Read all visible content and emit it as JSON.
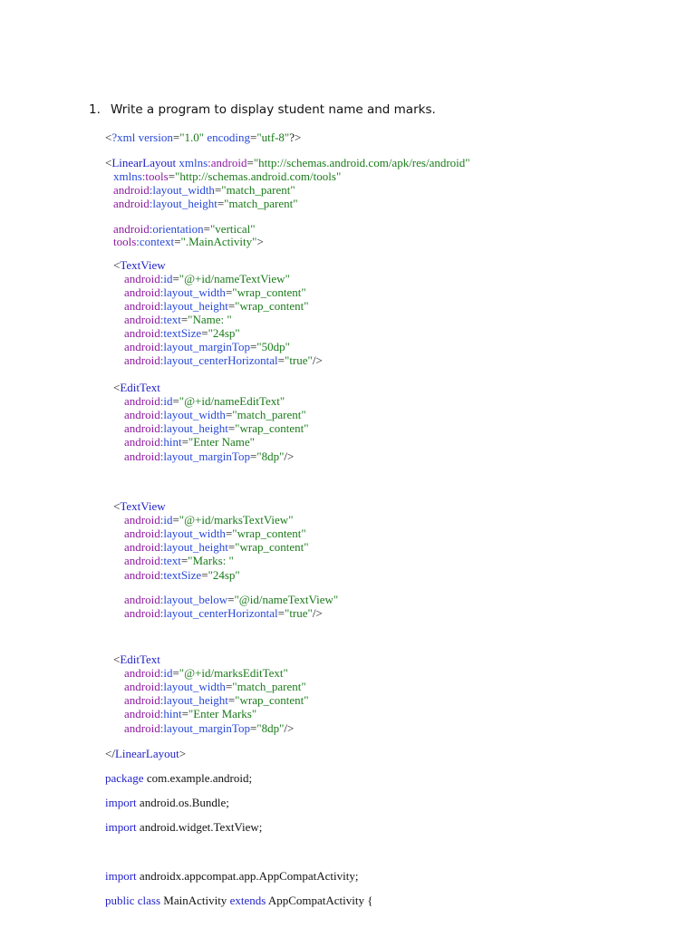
{
  "heading": {
    "number": "1.",
    "text": "Write a program to display student name and marks."
  },
  "code_lines": [
    [
      [
        "p",
        "<"
      ],
      [
        "a",
        "?xml version"
      ],
      [
        "p",
        "="
      ],
      [
        "v",
        "\"1.0\""
      ],
      [
        "a",
        " encoding"
      ],
      [
        "p",
        "="
      ],
      [
        "v",
        "\"utf-8\""
      ],
      [
        "p",
        "?>"
      ]
    ],
    [
      [
        "p",
        "<"
      ],
      [
        "t",
        "LinearLayout"
      ],
      [
        "a",
        " xmlns"
      ],
      [
        "ns",
        ":android"
      ],
      [
        "p",
        "="
      ],
      [
        "v",
        "\"http://schemas.android.com/apk/res/android\""
      ]
    ],
    [
      [
        "a",
        "xmlns"
      ],
      [
        "ns",
        ":tools"
      ],
      [
        "p",
        "="
      ],
      [
        "v",
        "\"http://schemas.android.com/tools\""
      ]
    ],
    [
      [
        "ns",
        "android"
      ],
      [
        "a",
        ":layout_width"
      ],
      [
        "p",
        "="
      ],
      [
        "v",
        "\"match_parent\""
      ]
    ],
    [
      [
        "ns",
        "android"
      ],
      [
        "a",
        ":layout_height"
      ],
      [
        "p",
        "="
      ],
      [
        "v",
        "\"match_parent\""
      ]
    ],
    [
      [
        "ns",
        "android"
      ],
      [
        "a",
        ":orientation"
      ],
      [
        "p",
        "="
      ],
      [
        "v",
        "\"vertical\""
      ]
    ],
    [
      [
        "ns",
        "tools"
      ],
      [
        "a",
        ":context"
      ],
      [
        "p",
        "="
      ],
      [
        "v",
        "\".MainActivity\""
      ],
      [
        "p",
        ">"
      ]
    ],
    [
      [
        "p",
        "<"
      ],
      [
        "t",
        "TextView"
      ]
    ],
    [
      [
        "ns",
        "android"
      ],
      [
        "a",
        ":id"
      ],
      [
        "p",
        "="
      ],
      [
        "v",
        "\"@+id/nameTextView\""
      ]
    ],
    [
      [
        "ns",
        "android"
      ],
      [
        "a",
        ":layout_width"
      ],
      [
        "p",
        "="
      ],
      [
        "v",
        "\"wrap_content\""
      ]
    ],
    [
      [
        "ns",
        "android"
      ],
      [
        "a",
        ":layout_height"
      ],
      [
        "p",
        "="
      ],
      [
        "v",
        "\"wrap_content\""
      ]
    ],
    [
      [
        "ns",
        "android"
      ],
      [
        "a",
        ":text"
      ],
      [
        "p",
        "="
      ],
      [
        "v",
        "\"Name: \""
      ]
    ],
    [
      [
        "ns",
        "android"
      ],
      [
        "a",
        ":textSize"
      ],
      [
        "p",
        "="
      ],
      [
        "v",
        "\"24sp\""
      ]
    ],
    [
      [
        "ns",
        "android"
      ],
      [
        "a",
        ":layout_marginTop"
      ],
      [
        "p",
        "="
      ],
      [
        "v",
        "\"50dp\""
      ]
    ],
    [
      [
        "ns",
        "android"
      ],
      [
        "a",
        ":layout_centerHorizontal"
      ],
      [
        "p",
        "="
      ],
      [
        "v",
        "\"true\""
      ],
      [
        "p",
        "/>"
      ]
    ],
    [
      [
        "p",
        "<"
      ],
      [
        "t",
        "EditText"
      ]
    ],
    [
      [
        "ns",
        "android"
      ],
      [
        "a",
        ":id"
      ],
      [
        "p",
        "="
      ],
      [
        "v",
        "\"@+id/nameEditText\""
      ]
    ],
    [
      [
        "ns",
        "android"
      ],
      [
        "a",
        ":layout_width"
      ],
      [
        "p",
        "="
      ],
      [
        "v",
        "\"match_parent\""
      ]
    ],
    [
      [
        "ns",
        "android"
      ],
      [
        "a",
        ":layout_height"
      ],
      [
        "p",
        "="
      ],
      [
        "v",
        "\"wrap_content\""
      ]
    ],
    [
      [
        "ns",
        "android"
      ],
      [
        "a",
        ":hint"
      ],
      [
        "p",
        "="
      ],
      [
        "v",
        "\"Enter Name\""
      ]
    ],
    [
      [
        "ns",
        "android"
      ],
      [
        "a",
        ":layout_marginTop"
      ],
      [
        "p",
        "="
      ],
      [
        "v",
        "\"8dp\""
      ],
      [
        "p",
        "/>"
      ]
    ],
    [
      [
        "p",
        "<"
      ],
      [
        "t",
        "TextView"
      ]
    ],
    [
      [
        "ns",
        "android"
      ],
      [
        "a",
        ":id"
      ],
      [
        "p",
        "="
      ],
      [
        "v",
        "\"@+id/marksTextView\""
      ]
    ],
    [
      [
        "ns",
        "android"
      ],
      [
        "a",
        ":layout_width"
      ],
      [
        "p",
        "="
      ],
      [
        "v",
        "\"wrap_content\""
      ]
    ],
    [
      [
        "ns",
        "android"
      ],
      [
        "a",
        ":layout_height"
      ],
      [
        "p",
        "="
      ],
      [
        "v",
        "\"wrap_content\""
      ]
    ],
    [
      [
        "ns",
        "android"
      ],
      [
        "a",
        ":text"
      ],
      [
        "p",
        "="
      ],
      [
        "v",
        "\"Marks: \""
      ]
    ],
    [
      [
        "ns",
        "android"
      ],
      [
        "a",
        ":textSize"
      ],
      [
        "p",
        "="
      ],
      [
        "v",
        "\"24sp\""
      ]
    ],
    [
      [
        "ns",
        "android"
      ],
      [
        "a",
        ":layout_below"
      ],
      [
        "p",
        "="
      ],
      [
        "v",
        "\"@id/nameTextView\""
      ]
    ],
    [
      [
        "ns",
        "android"
      ],
      [
        "a",
        ":layout_centerHorizontal"
      ],
      [
        "p",
        "="
      ],
      [
        "v",
        "\"true\""
      ],
      [
        "p",
        "/>"
      ]
    ],
    [
      [
        "p",
        "<"
      ],
      [
        "t",
        "EditText"
      ]
    ],
    [
      [
        "ns",
        "android"
      ],
      [
        "a",
        ":id"
      ],
      [
        "p",
        "="
      ],
      [
        "v",
        "\"@+id/marksEditText\""
      ]
    ],
    [
      [
        "ns",
        "android"
      ],
      [
        "a",
        ":layout_width"
      ],
      [
        "p",
        "="
      ],
      [
        "v",
        "\"match_parent\""
      ]
    ],
    [
      [
        "ns",
        "android"
      ],
      [
        "a",
        ":layout_height"
      ],
      [
        "p",
        "="
      ],
      [
        "v",
        "\"wrap_content\""
      ]
    ],
    [
      [
        "ns",
        "android"
      ],
      [
        "a",
        ":hint"
      ],
      [
        "p",
        "="
      ],
      [
        "v",
        "\"Enter Marks\""
      ]
    ],
    [
      [
        "ns",
        "android"
      ],
      [
        "a",
        ":layout_marginTop"
      ],
      [
        "p",
        "="
      ],
      [
        "v",
        "\"8dp\""
      ],
      [
        "p",
        "/>"
      ]
    ],
    [
      [
        "p",
        "</"
      ],
      [
        "t",
        "LinearLayout"
      ],
      [
        "p",
        ">"
      ]
    ],
    [
      [
        "k",
        "package"
      ],
      [
        "x",
        " com.example.android;"
      ]
    ],
    [
      [
        "k",
        "import"
      ],
      [
        "x",
        " android.os.Bundle;"
      ]
    ],
    [
      [
        "k",
        "import"
      ],
      [
        "x",
        " android.widget.TextView;"
      ]
    ],
    [
      [
        "k",
        "import"
      ],
      [
        "x",
        " androidx.appcompat.app.AppCompatActivity;"
      ]
    ],
    [
      [
        "k",
        "public class"
      ],
      [
        "x",
        " MainActivity "
      ],
      [
        "k",
        "extends"
      ],
      [
        "x",
        " AppCompatActivity {"
      ]
    ]
  ]
}
